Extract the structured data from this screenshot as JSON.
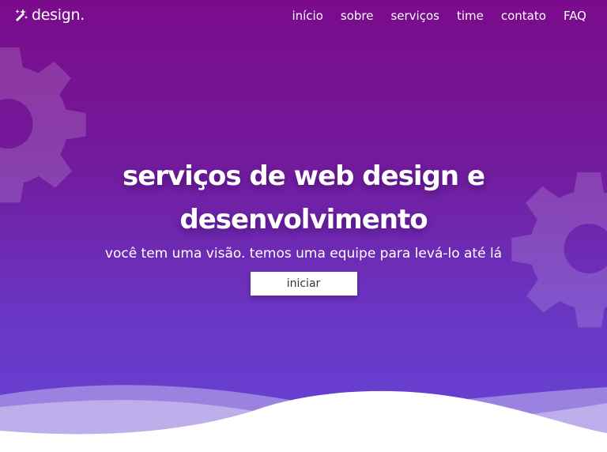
{
  "brand": {
    "name": "design.",
    "icon": "magic-wand-icon"
  },
  "nav": {
    "items": [
      {
        "label": "início"
      },
      {
        "label": "sobre"
      },
      {
        "label": "serviços"
      },
      {
        "label": "time"
      },
      {
        "label": "contato"
      },
      {
        "label": "FAQ"
      }
    ]
  },
  "hero": {
    "title_line1": "serviços de web design e",
    "title_line2": "desenvolvimento",
    "subtitle": "você tem uma visão. temos uma equipe para levá-lo até lá",
    "cta_label": "iniciar",
    "decor_icon": "gear-icon"
  },
  "colors": {
    "gradient_top": "#7a0b8c",
    "gradient_bottom": "#6545d6",
    "button_bg": "#ffffff",
    "text": "#ffffff"
  }
}
